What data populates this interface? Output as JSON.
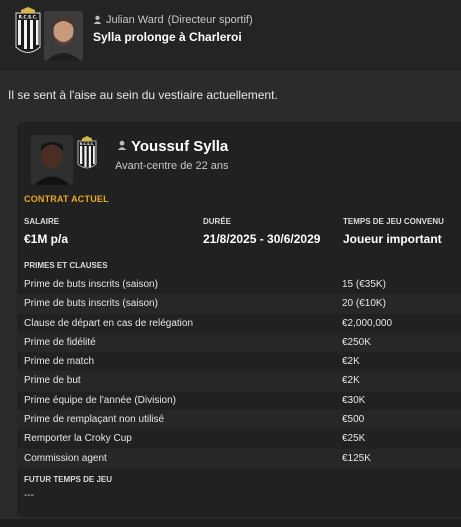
{
  "message": {
    "club_crest_text": "R.C.S.C.",
    "sender_name": "Julian Ward",
    "sender_role": "(Directeur sportif)",
    "subject": "Sylla prolonge à Charleroi",
    "body_text": "Il se sent à l'aise au sein du vestiaire actuellement."
  },
  "player": {
    "name": "Youssuf Sylla",
    "subtitle": "Avant-centre de 22 ans",
    "crest_text": "R.C.S.C."
  },
  "contract": {
    "section_title": "CONTRAT ACTUEL",
    "salary_label": "SALAIRE",
    "salary_value": "€1M p/a",
    "duration_label": "DURÉE",
    "duration_value": "21/8/2025 - 30/6/2029",
    "playtime_label": "TEMPS DE JEU CONVENU",
    "playtime_value": "Joueur important",
    "primes_title": "PRIMES ET CLAUSES",
    "clauses": [
      {
        "name": "Prime de buts inscrits (saison)",
        "value": "15 (€35K)"
      },
      {
        "name": "Prime de buts inscrits (saison)",
        "value": "20 (€10K)"
      },
      {
        "name": "Clause de départ en cas de relégation",
        "value": "€2,000,000"
      },
      {
        "name": "Prime de fidélité",
        "value": "€250K"
      },
      {
        "name": "Prime de match",
        "value": "€2K"
      },
      {
        "name": "Prime de but",
        "value": "€2K"
      },
      {
        "name": "Prime équipe de l'année (Division)",
        "value": "€30K"
      },
      {
        "name": "Prime de remplaçant non utilisé",
        "value": "€500"
      },
      {
        "name": "Remporter la Croky Cup",
        "value": "€25K"
      },
      {
        "name": "Commission agent",
        "value": "€125K"
      }
    ],
    "future_title": "FUTUR TEMPS DE JEU",
    "future_value": "---"
  },
  "colors": {
    "accent": "#e9a825",
    "background": "#2b2b2b",
    "card": "#212121",
    "header": "#242424"
  },
  "icons": [
    "club-crest-icon",
    "person-icon"
  ]
}
